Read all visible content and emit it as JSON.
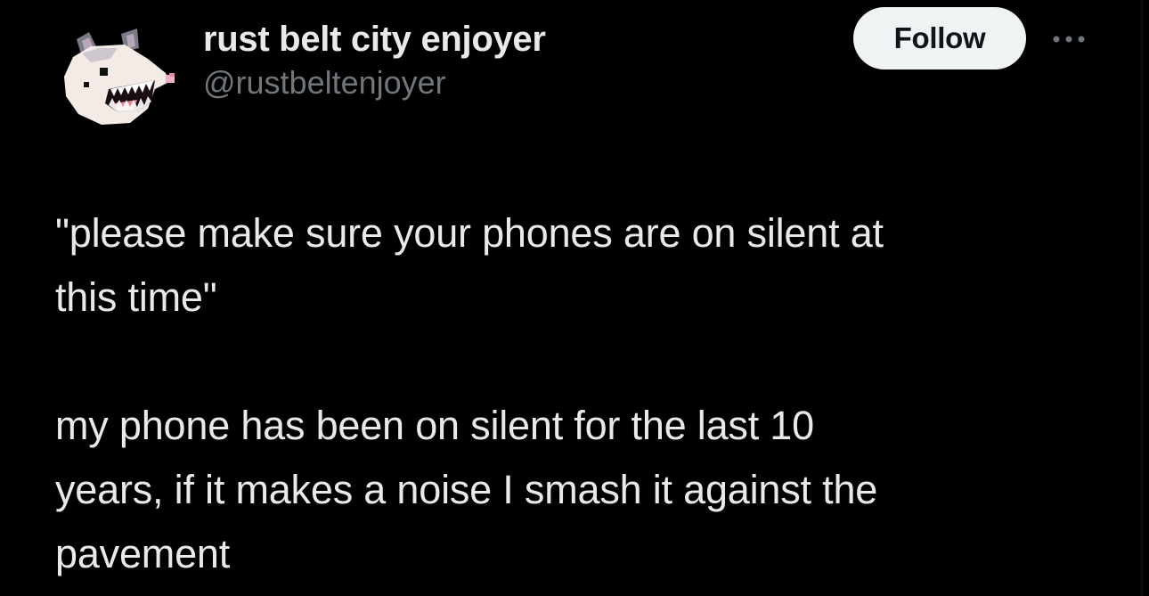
{
  "author": {
    "display_name": "rust belt city enjoyer",
    "handle": "@rustbeltenjoyer",
    "avatar_icon": "opossum-pixel-avatar"
  },
  "actions": {
    "follow_label": "Follow",
    "more_icon": "more-horizontal-icon"
  },
  "tweet": {
    "paragraphs": [
      "\"please make sure your phones are on silent at\nthis time\"",
      "my phone has been on silent for the last 10\nyears, if it makes a noise I smash it against the\npavement"
    ]
  },
  "colors": {
    "background": "#000000",
    "text_primary": "#e7e9ea",
    "text_secondary": "#71767b",
    "follow_bg": "#eff3f4",
    "follow_text": "#0f1419"
  }
}
